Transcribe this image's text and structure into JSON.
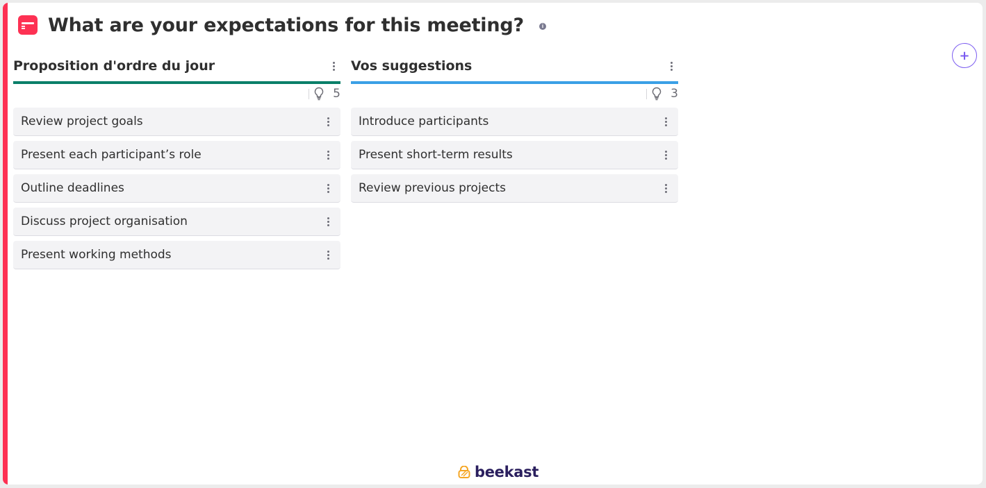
{
  "header": {
    "title": "What are your expectations for this meeting?",
    "info_icon": "info-icon",
    "app_icon": "wall-app-icon"
  },
  "add_column_button": {
    "label": "+",
    "icon": "plus-icon"
  },
  "colors": {
    "accent": "#fd3153",
    "column_1": "#0a7f69",
    "column_2": "#3aa0e6",
    "add_button": "#7b5cf0",
    "brand": "#2a1f5e"
  },
  "columns": [
    {
      "title": "Proposition d'ordre du jour",
      "count": "5",
      "count_icon": "lightbulb-icon",
      "cards": [
        {
          "text": "Review project goals"
        },
        {
          "text": "Present each participant’s role"
        },
        {
          "text": "Outline deadlines"
        },
        {
          "text": "Discuss project organisation"
        },
        {
          "text": "Present working methods"
        }
      ]
    },
    {
      "title": "Vos suggestions",
      "count": "3",
      "count_icon": "lightbulb-icon",
      "cards": [
        {
          "text": "Introduce participants"
        },
        {
          "text": "Present short-term results"
        },
        {
          "text": "Review previous projects"
        }
      ]
    }
  ],
  "footer": {
    "brand": "beekast"
  }
}
